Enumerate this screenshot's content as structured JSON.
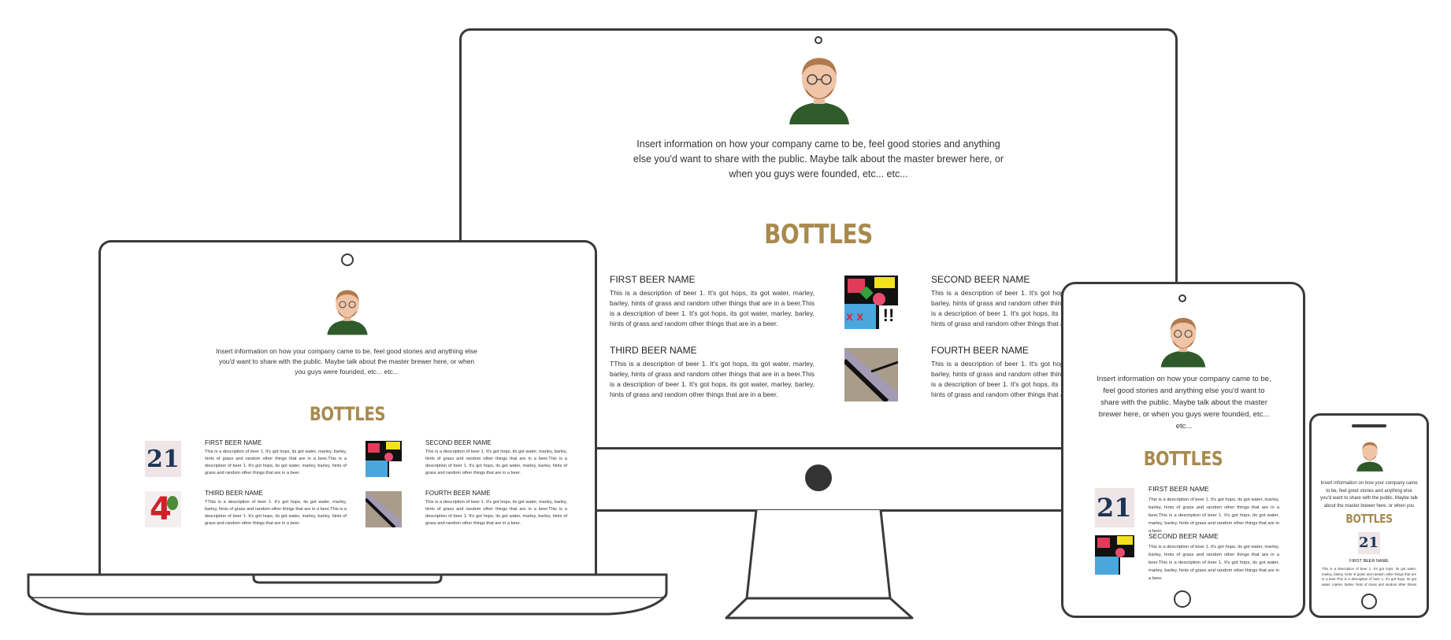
{
  "about_text": "Insert information on how your company came to be, feel good stories and anything else you'd want to share with the public. Maybe talk about the master brewer here, or when you guys were founded, etc... etc...",
  "about_text_tablet": "Insert information on how your company came to be, feel good stories and anything else you'd want to share with the public. Maybe talk about the master brewer here, or when you guys were founded, etc... etc...",
  "heading": "BOTTLES",
  "beers": [
    {
      "name": "FIRST BEER NAME",
      "desc": "This is a description of beer 1. It's got hops, its got water, marley, barley, hints of grass and random other things that are in a beer.This is a description of beer 1. It's got hops, its got water, marley, barley, hints of grass and random other things that are in a beer."
    },
    {
      "name": "SECOND BEER NAME",
      "desc": "This is a description of beer 1. It's got hops, its got water, marley, barley, hints of grass and random other things that are in a beer.This is a description of beer 1. It's got hops, its got water, marley, barley, hints of grass and random other things that are in a beer."
    },
    {
      "name": "THIRD BEER NAME",
      "desc": "TThis is a description of beer 1. It's got hops, its got water, marley, barley, hints of grass and random other things that are in a beer.This is a description of beer 1. It's got hops, its got water, marley, barley, hints of grass and random other things that are in a beer."
    },
    {
      "name": "FOURTH BEER NAME",
      "desc": "This is a description of beer 1. It's got hops, its got water, marley, barley, hints of grass and random other things that are in a beer.This is a description of beer 1. It's got hops, its got water, marley, barley, hints of grass and random other things that are in a beer."
    }
  ],
  "phone_desc": "This is a description of beer 1. It's got hops, its got water, marley, barley, hints of grass and random other things that are in a beer.This is a description of beer 1. It's got hops, its got water, marley, barley, hints of grass and random other things that are in a beer.",
  "thumb_labels": {
    "n21": "21",
    "n4": "4",
    "xx": "x x",
    "excl": "!!"
  },
  "colors": {
    "heading": "#a88a4f",
    "frame": "#3a3a3a",
    "shirt": "#2f5a2a"
  },
  "icons": [
    "avatar-icon",
    "camera-icon",
    "home-button-icon"
  ]
}
